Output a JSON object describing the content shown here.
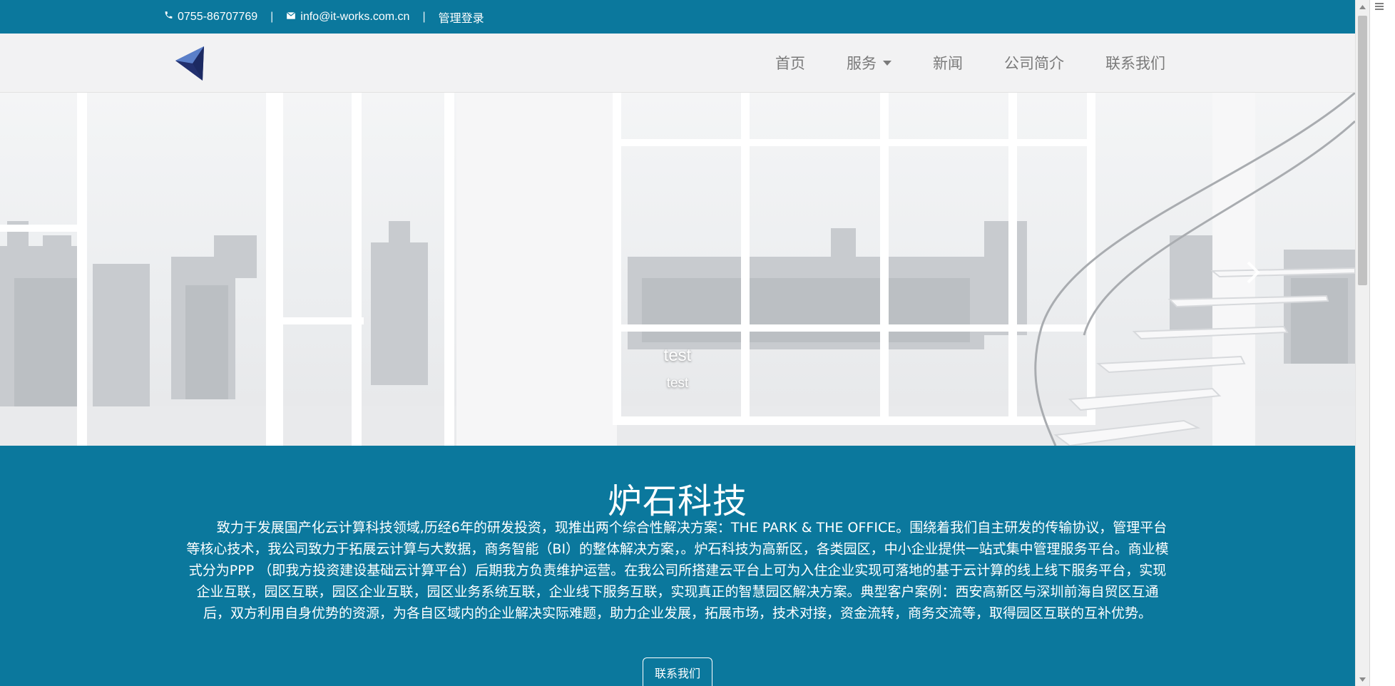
{
  "brand_color": "#0b789d",
  "topbar": {
    "phone": "0755-86707769",
    "separator": "|",
    "email": "info@it-works.com.cn",
    "admin_login": "管理登录",
    "phone_icon": "phone-icon",
    "email_icon": "envelope-icon"
  },
  "navbar": {
    "logo": "triangle-logo",
    "items": [
      {
        "label": "首页"
      },
      {
        "label": "服务",
        "has_dropdown": true
      },
      {
        "label": "新闻"
      },
      {
        "label": "公司简介"
      },
      {
        "label": "联系我们"
      }
    ]
  },
  "hero": {
    "caption_title": "test",
    "caption_subtitle": "test",
    "indicator_count": 2,
    "active_indicator": 0,
    "next_control": "chevron-right-icon"
  },
  "about": {
    "title": "炉石科技",
    "body": "致力于发展国产化云计算科技领域,历经6年的研发投资，现推出两个综合性解决方案：THE PARK & THE OFFICE。围绕着我们自主研发的传输协议，管理平台等核心技术，我公司致力于拓展云计算与大数据，商务智能（BI）的整体解决方案，。炉石科技为高新区，各类园区，中小企业提供一站式集中管理服务平台。商业模式分为PPP （即我方投资建设基础云计算平台）后期我方负责维护运营。在我公司所搭建云平台上可为入住企业实现可落地的基于云计算的线上线下服务平台，实现企业互联，园区互联，园区企业互联，园区业务系统互联，企业线下服务互联，实现真正的智慧园区解决方案。典型客户案例：西安高新区与深圳前海自贸区互通后，双方利用自身优势的资源，为各自区域内的企业解决实际难题，助力企业发展，拓展市场，技术对接，资金流转，商务交流等，取得园区互联的互补优势。",
    "contact_button": "联系我们"
  }
}
